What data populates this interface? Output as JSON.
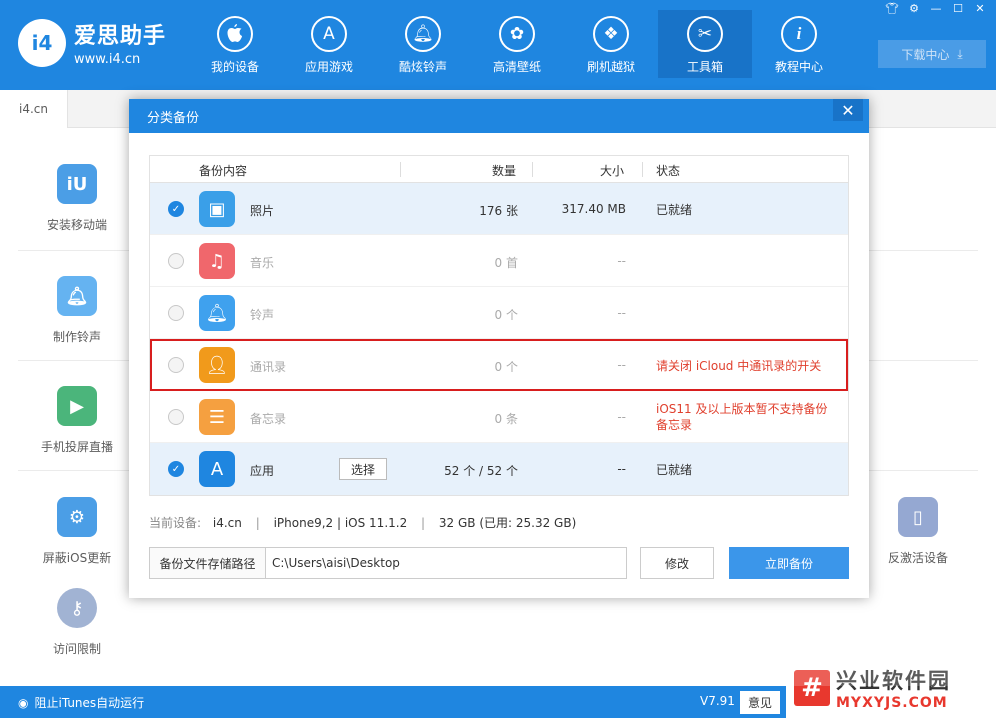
{
  "app": {
    "name": "爱思助手",
    "url": "www.i4.cn",
    "logo_mark": "i4"
  },
  "nav": [
    {
      "label": "我的设备",
      "icon": "apple-icon"
    },
    {
      "label": "应用游戏",
      "icon": "app-store-icon"
    },
    {
      "label": "酷炫铃声",
      "icon": "bell-icon"
    },
    {
      "label": "高清壁纸",
      "icon": "flower-icon"
    },
    {
      "label": "刷机越狱",
      "icon": "dropbox-icon"
    },
    {
      "label": "工具箱",
      "icon": "tools-icon"
    },
    {
      "label": "教程中心",
      "icon": "info-icon"
    }
  ],
  "download_center": "下载中心",
  "tab": "i4.cn",
  "tools": {
    "install_mobile": "安装移动端",
    "make_ringtone": "制作铃声",
    "screen_cast": "手机投屏直播",
    "block_ios_update": "屏蔽iOS更新",
    "access_limit": "访问限制",
    "deactivate": "反激活设备"
  },
  "status_bar": {
    "itunes": "阻止iTunes自动运行",
    "version": "V7.91",
    "feedback": "意见"
  },
  "watermark": {
    "cn": "兴业软件园",
    "en": "MYXYJS.COM",
    "badge": "#"
  },
  "modal": {
    "title": "分类备份",
    "close": "✕",
    "headers": {
      "content": "备份内容",
      "count": "数量",
      "size": "大小",
      "status": "状态"
    },
    "rows": [
      {
        "name": "照片",
        "count": "176 张",
        "size": "317.40 MB",
        "status": "已就绪",
        "checked": true
      },
      {
        "name": "音乐",
        "count": "0 首",
        "size": "--",
        "status": "",
        "checked": false
      },
      {
        "name": "铃声",
        "count": "0 个",
        "size": "--",
        "status": "",
        "checked": false
      },
      {
        "name": "通讯录",
        "count": "0 个",
        "size": "--",
        "status": "请关闭 iCloud 中通讯录的开关",
        "checked": false
      },
      {
        "name": "备忘录",
        "count": "0 条",
        "size": "--",
        "status": "iOS11 及以上版本暂不支持备份备忘录",
        "checked": false
      },
      {
        "name": "应用",
        "count": "52 个 / 52 个",
        "size": "--",
        "status": "已就绪",
        "checked": true,
        "button": "选择"
      }
    ],
    "device": {
      "label": "当前设备:",
      "name": "i4.cn",
      "model": "iPhone9,2 | iOS 11.1.2",
      "storage": "32 GB (已用: 25.32 GB)"
    },
    "path_label": "备份文件存储路径",
    "path_value": "C:\\Users\\aisi\\Desktop",
    "modify": "修改",
    "backup_now": "立即备份"
  }
}
